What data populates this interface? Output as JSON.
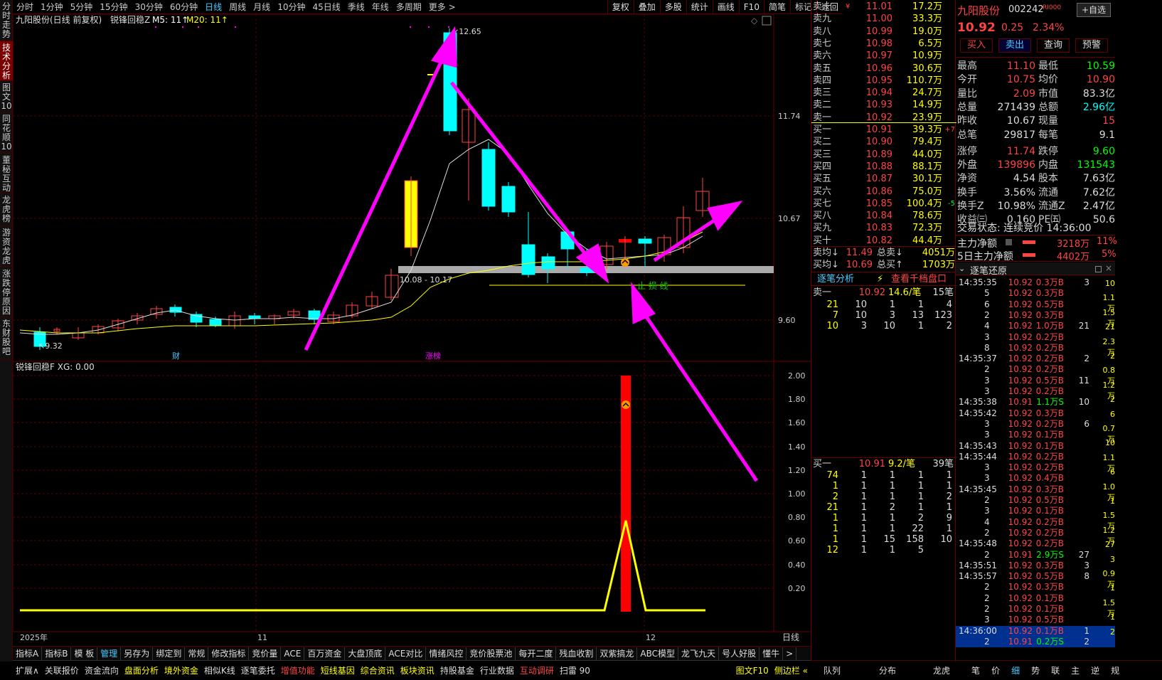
{
  "left_tabs": [
    "分时走势",
    "技术分析",
    "图文10",
    "同花顺10",
    "董秘互动",
    "龙虎榜",
    "游资龙虎",
    "涨跌停原因",
    "东财股吧"
  ],
  "period_tabs": [
    "分时",
    "1分钟",
    "5分钟",
    "15分钟",
    "30分钟",
    "60分钟",
    "日线",
    "周线",
    "月线",
    "10分钟",
    "45日线",
    "季线",
    "年线",
    "多周期",
    "更多 >"
  ],
  "active_period": "日线",
  "right_tools": [
    "复权",
    "叠加",
    "多股",
    "统计",
    "画线",
    "F10",
    "简笔",
    "标记",
    "返回"
  ],
  "chart_header": {
    "name": "九阳股份(日线 前复权)",
    "indicator": "锐锋回稳Z",
    "m5": "M5: 11↑",
    "m20": "M20: 11↑"
  },
  "price_labels": [
    "11.74",
    "10.67",
    "9.60"
  ],
  "annotations": {
    "high": "12.65",
    "low": "9.32",
    "band": "10.08 - 10.17",
    "support": "止 损 线",
    "news1": "财",
    "news2": "涨榜"
  },
  "time_labels": [
    "2025年",
    "11",
    "12"
  ],
  "sub_header": "锐锋回稳F  XG: 0.00",
  "sub_labels": [
    "2.00",
    "1.80",
    "1.60",
    "1.40",
    "1.20",
    "1.00",
    "0.80",
    "0.60",
    "0.40",
    "0.20"
  ],
  "sub_period": "日线",
  "bottom_tabs1": [
    "指标A",
    "指标B",
    "模 板",
    "管理",
    "另存为",
    "绑定到",
    "常规",
    "修改指标",
    "竞价量",
    "ACE",
    "百万资金",
    "大盘顶底",
    "ACE对比",
    "情绪风控",
    "竞价股票池",
    "每开二度",
    "残血收割",
    "双紫搞龙",
    "ABC模型",
    "龙飞九天",
    "号人好股",
    "懂牛",
    ">"
  ],
  "bottom_tabs2": [
    "扩展∧",
    "关联报价",
    "资金流向",
    "盘面分析",
    "境外资金",
    "相似K线",
    "逐笔委托",
    "增值功能",
    "短线基因",
    "综合资讯",
    "板块资讯",
    "持股基金",
    "行业数据",
    "互动调研",
    "扫雷 90",
    "图文F10",
    "侧边栏 «"
  ],
  "sells": [
    {
      "l": "卖十",
      "p": "11.01",
      "v": "17.2万",
      "m": "¥"
    },
    {
      "l": "卖九",
      "p": "11.00",
      "v": "33.3万"
    },
    {
      "l": "卖八",
      "p": "10.99",
      "v": "19.0万"
    },
    {
      "l": "卖七",
      "p": "10.98",
      "v": "6.5万"
    },
    {
      "l": "卖六",
      "p": "10.97",
      "v": "10.9万"
    },
    {
      "l": "卖五",
      "p": "10.96",
      "v": "30.6万"
    },
    {
      "l": "卖四",
      "p": "10.95",
      "v": "110.7万"
    },
    {
      "l": "卖三",
      "p": "10.94",
      "v": "24.7万"
    },
    {
      "l": "卖二",
      "p": "10.93",
      "v": "14.9万"
    },
    {
      "l": "卖一",
      "p": "10.92",
      "v": "23.9万"
    }
  ],
  "buys": [
    {
      "l": "买一",
      "p": "10.91",
      "v": "39.3万",
      "e": "+7"
    },
    {
      "l": "买二",
      "p": "10.90",
      "v": "79.4万"
    },
    {
      "l": "买三",
      "p": "10.89",
      "v": "44.0万"
    },
    {
      "l": "买四",
      "p": "10.88",
      "v": "88.1万"
    },
    {
      "l": "买五",
      "p": "10.87",
      "v": "30.1万"
    },
    {
      "l": "买六",
      "p": "10.86",
      "v": "75.0万"
    },
    {
      "l": "买七",
      "p": "10.85",
      "v": "100.4万",
      "e": "-5"
    },
    {
      "l": "买八",
      "p": "10.84",
      "v": "78.6万"
    },
    {
      "l": "买九",
      "p": "10.83",
      "v": "72.3万"
    },
    {
      "l": "买十",
      "p": "10.82",
      "v": "44.4万"
    }
  ],
  "avg": [
    {
      "l": "卖均↓",
      "p": "11.49",
      "t": "总卖↓",
      "v": "4051万"
    },
    {
      "l": "买均↓",
      "p": "10.69",
      "t": "总买↑",
      "v": "1703万"
    }
  ],
  "tick_head": {
    "a": "逐笔分析",
    "b": "查看千档盘口"
  },
  "sell1_q": {
    "l": "卖一",
    "p": "10.92",
    "a": "14.6/笔",
    "n": "15笔",
    "rows": [
      [
        "21",
        "10",
        "1",
        "1",
        "4"
      ],
      [
        "7",
        "10",
        "3",
        "13",
        "123"
      ],
      [
        "10",
        "3",
        "10",
        "1",
        "2"
      ]
    ]
  },
  "buy1_q": {
    "l": "买一",
    "p": "10.91",
    "a": "9.2/笔",
    "n": "39笔",
    "rows": [
      [
        "74",
        "1",
        "1",
        "1",
        "1"
      ],
      [
        "1",
        "1",
        "1",
        "1",
        "1"
      ],
      [
        "2",
        "1",
        "1",
        "1",
        "2"
      ],
      [
        "21",
        "1",
        "2",
        "1",
        "1"
      ],
      [
        "1",
        "1",
        "1",
        "2",
        "9"
      ],
      [
        "1",
        "1",
        "1",
        "22",
        "1"
      ],
      [
        "1",
        "1",
        "15",
        "158",
        "10"
      ],
      [
        "12",
        "1",
        "1",
        "5",
        ""
      ]
    ]
  },
  "stock": {
    "name": "九阳股份",
    "code": "002242",
    "tag": "RI000",
    "self": "+自选",
    "price": "10.92",
    "chg": "0.25",
    "pct": "2.34%"
  },
  "actions": [
    "买入",
    "卖出",
    "查询",
    "预警"
  ],
  "stats": [
    [
      "最高",
      "11.10",
      "最低",
      "10.59"
    ],
    [
      "今开",
      "10.75",
      "均价",
      "10.90"
    ],
    [
      "量比",
      "2.09",
      "市值",
      "83.3亿"
    ],
    [
      "总量",
      "271439",
      "总额",
      "2.96亿"
    ],
    [
      "昨收",
      "10.67",
      "现量",
      "15"
    ],
    [
      "总笔",
      "29817",
      "每笔",
      "9.1"
    ],
    [
      "涨停",
      "11.74",
      "跌停",
      "9.60"
    ],
    [
      "外盘",
      "139896",
      "内盘",
      "131543"
    ],
    [
      "净资",
      "4.54",
      "股本",
      "7.63亿"
    ],
    [
      "换手",
      "3.56%",
      "流通",
      "7.62亿"
    ],
    [
      "换手Z",
      "10.98%",
      "流通Z",
      "2.47亿"
    ],
    [
      "收益㈢",
      "0.160",
      "PE㈤",
      "50.6"
    ]
  ],
  "trade_state": "交易状态: 连续竞价 14:36:00",
  "main_flow": {
    "l1": "主力净额",
    "v1": "3218万",
    "p1": "11%",
    "l2": "5日主力净额",
    "v2": "4402万",
    "p2": "5%"
  },
  "tick_title": "逐笔还原",
  "ticks": [
    [
      "14:35:35",
      "10.92",
      "0.3万B",
      "3",
      "10"
    ],
    [
      "5",
      "10.92",
      "0.3万B",
      "",
      ""
    ],
    [
      "6",
      "10.92",
      "0.5万B",
      "",
      ""
    ],
    [
      "2",
      "10.92",
      "0.3万B",
      "",
      ""
    ],
    [
      "4",
      "10.92",
      "1.0万B",
      "21",
      ""
    ],
    [
      "3",
      "10.92",
      "0.2万B",
      "",
      ""
    ],
    [
      "8",
      "10.92",
      "0.2万B",
      "",
      ""
    ],
    [
      "14:35:37",
      "10.92",
      "0.2万B",
      "2",
      ""
    ],
    [
      "2",
      "10.92",
      "0.2万B",
      "",
      ""
    ],
    [
      "3",
      "10.92",
      "0.5万B",
      "11",
      ""
    ],
    [
      "3",
      "10.92",
      "0.2万B",
      "",
      ""
    ],
    [
      "14:35:38",
      "10.91",
      "1.1万S",
      "10",
      ""
    ],
    [
      "14:35:42",
      "10.92",
      "0.3万B",
      "",
      ""
    ],
    [
      "3",
      "10.92",
      "0.2万B",
      "6",
      ""
    ],
    [
      "3",
      "10.92",
      "0.1万B",
      "",
      ""
    ],
    [
      "14:35:43",
      "10.92",
      "0.1万B",
      "",
      ""
    ],
    [
      "14:35:44",
      "10.92",
      "0.2万B",
      "",
      ""
    ],
    [
      "3",
      "10.92",
      "0.2万B",
      "",
      ""
    ],
    [
      "3",
      "10.92",
      "0.4万B",
      "",
      ""
    ],
    [
      "14:35:45",
      "10.92",
      "0.3万B",
      "",
      ""
    ],
    [
      "2",
      "10.92",
      "0.5万B",
      "",
      ""
    ],
    [
      "3",
      "10.92",
      "0.1万B",
      "",
      ""
    ],
    [
      "4",
      "10.92",
      "0.2万B",
      "",
      ""
    ],
    [
      "2",
      "10.92",
      "0.2万B",
      "",
      ""
    ],
    [
      "14:35:48",
      "10.92",
      "0.2万B",
      "",
      ""
    ],
    [
      "2",
      "10.91",
      "2.9万S",
      "27",
      ""
    ],
    [
      "14:35:51",
      "10.92",
      "0.3万B",
      "3",
      ""
    ],
    [
      "14:35:57",
      "10.92",
      "0.5万B",
      "8",
      ""
    ],
    [
      "2",
      "10.92",
      "0.3万B",
      "",
      ""
    ],
    [
      "2",
      "10.92",
      "0.1万B",
      "",
      ""
    ],
    [
      "2",
      "10.92",
      "0.1万B",
      "",
      ""
    ],
    [
      "3",
      "10.92",
      "0.5万B",
      "",
      ""
    ],
    [
      "14:36:00",
      "10.92",
      "0.1万B",
      "1",
      ""
    ],
    [
      "2",
      "10.91",
      "0.2万S",
      "2",
      ""
    ]
  ],
  "ticks_side": [
    "10",
    "1.1万",
    "1.5万",
    "21",
    "2.3万",
    "2",
    "0.8万",
    "1.2万",
    "2",
    "6",
    "0.7万",
    "10",
    "1.1万",
    "6",
    "1.0万",
    "1",
    "1.5万",
    "1.2万",
    "27",
    "3",
    "0.9万",
    "1",
    "1.5万",
    "1",
    "2"
  ],
  "footer_right": [
    "队列",
    "分布",
    "龙虎",
    "笔",
    "价",
    "细",
    "势",
    "联",
    "主",
    "逆",
    "规"
  ]
}
